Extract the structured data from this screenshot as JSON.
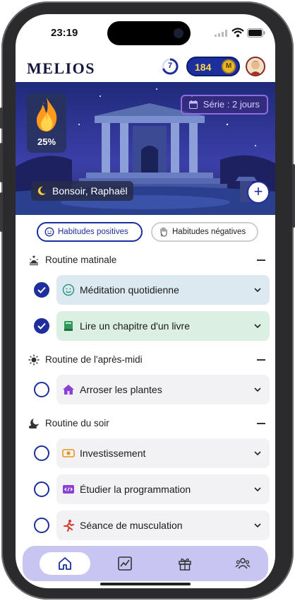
{
  "status_bar": {
    "time": "23:19"
  },
  "header": {
    "logo": "MELIOS",
    "level": "7",
    "coins": "184",
    "coin_symbol": "M"
  },
  "hero": {
    "progress_percent": "25%",
    "streak": "Série : 2 jours",
    "greeting": "Bonsoir, Raphaël",
    "add_symbol": "+"
  },
  "tabs": {
    "positive": "Habitudes positives",
    "negative": "Habitudes négatives"
  },
  "routines": [
    {
      "title": "Routine matinale",
      "habits": [
        {
          "label": "Méditation quotidienne",
          "done": true,
          "icon": "smile-icon",
          "color": "#dde9f1"
        },
        {
          "label": "Lire un chapitre d'un livre",
          "done": true,
          "icon": "book-icon",
          "color": "#dcefe3"
        }
      ]
    },
    {
      "title": "Routine de l'après-midi",
      "habits": [
        {
          "label": "Arroser les plantes",
          "done": false,
          "icon": "house-icon",
          "color": "#f2f2f4"
        }
      ]
    },
    {
      "title": "Routine du soir",
      "habits": [
        {
          "label": "Investissement",
          "done": false,
          "icon": "money-icon",
          "color": "#f2f2f4"
        },
        {
          "label": "Étudier la programmation",
          "done": false,
          "icon": "code-icon",
          "color": "#f2f2f4"
        },
        {
          "label": "Séance de musculation",
          "done": false,
          "icon": "run-icon",
          "color": "#f2f2f4"
        }
      ]
    }
  ],
  "colors": {
    "primary": "#1c2f9c",
    "tabbar": "#c9c5f3",
    "coin_text": "#ffd84c",
    "streak_border": "#8b6fe0"
  },
  "tabbar_icons": [
    "home-icon",
    "chart-icon",
    "gift-icon",
    "community-icon"
  ]
}
